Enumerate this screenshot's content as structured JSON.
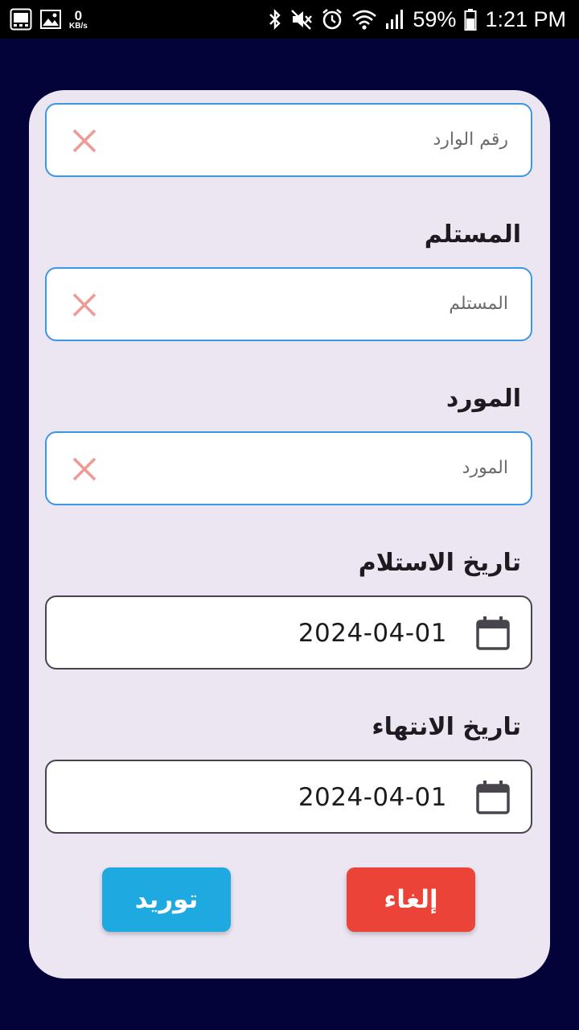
{
  "status_bar": {
    "net_speed_value": "0",
    "net_speed_unit": "KB/s",
    "battery": "59%",
    "time": "1:21 PM"
  },
  "form": {
    "incoming_number": {
      "placeholder": "رقم الوارد"
    },
    "receiver": {
      "label": "المستلم",
      "placeholder": "المستلم"
    },
    "supplier": {
      "label": "المورد",
      "placeholder": "المورد"
    },
    "receive_date": {
      "label": "تاريخ الاستلام",
      "value": "2024-04-01"
    },
    "end_date": {
      "label": "تاريخ الانتهاء",
      "value": "2024-04-01"
    }
  },
  "buttons": {
    "supply": {
      "label": "توريد",
      "color": "#1ea9e0"
    },
    "cancel": {
      "label": "إلغاء",
      "color": "#ec4339"
    }
  },
  "colors": {
    "background": "#03033a",
    "card": "#ece6f3",
    "text_field_border": "#3a97e6",
    "clear_icon": "#ef9a94"
  }
}
